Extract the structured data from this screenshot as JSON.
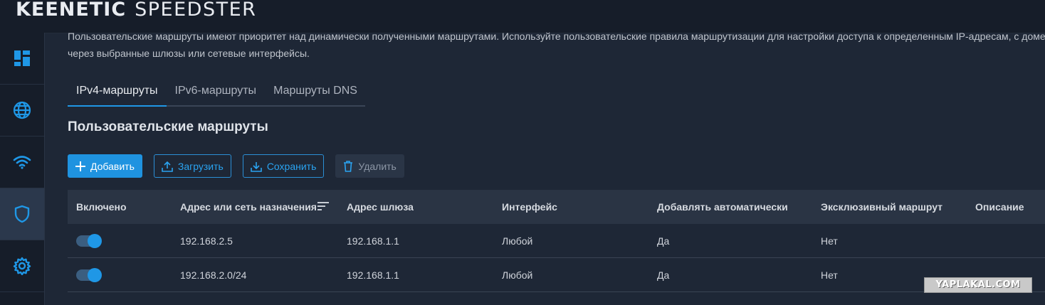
{
  "app": {
    "brand_part1": "KEENETIC",
    "brand_part2": "SPEEDSTER"
  },
  "sidebar": {
    "items": [
      {
        "icon": "dashboard-icon",
        "active": false
      },
      {
        "icon": "globe-icon",
        "active": false
      },
      {
        "icon": "wifi-icon",
        "active": false
      },
      {
        "icon": "shield-icon",
        "active": true
      },
      {
        "icon": "gear-icon",
        "active": false
      }
    ]
  },
  "description": "Пользовательские маршруты имеют приоритет над динамически полученными маршрутами. Используйте пользовательские правила маршрутизации для настройки доступа к определенным IP-адресам, с доменам через выбранные шлюзы или сетевые интерфейсы.",
  "tabs": [
    {
      "label": "IPv4-маршруты",
      "active": true
    },
    {
      "label": "IPv6-маршруты",
      "active": false
    },
    {
      "label": "Маршруты DNS",
      "active": false
    }
  ],
  "section_title": "Пользовательские маршруты",
  "toolbar": {
    "add_label": "Добавить",
    "upload_label": "Загрузить",
    "save_label": "Сохранить",
    "delete_label": "Удалить"
  },
  "table": {
    "headers": [
      "Включено",
      "Адрес или сеть назначения",
      "Адрес шлюза",
      "Интерфейс",
      "Добавлять автоматически",
      "Эксклюзивный маршрут",
      "Описание"
    ],
    "rows": [
      {
        "enabled": true,
        "destination": "192.168.2.5",
        "gateway": "192.168.1.1",
        "interface": "Любой",
        "auto": "Да",
        "exclusive": "Нет",
        "description": ""
      },
      {
        "enabled": true,
        "destination": "192.168.2.0/24",
        "gateway": "192.168.1.1",
        "interface": "Любой",
        "auto": "Да",
        "exclusive": "Нет",
        "description": ""
      }
    ]
  },
  "watermark": "YAPLAKAL.COM",
  "colors": {
    "accent": "#1f97e6",
    "background": "#1e2736",
    "sidebar": "#161d29"
  }
}
